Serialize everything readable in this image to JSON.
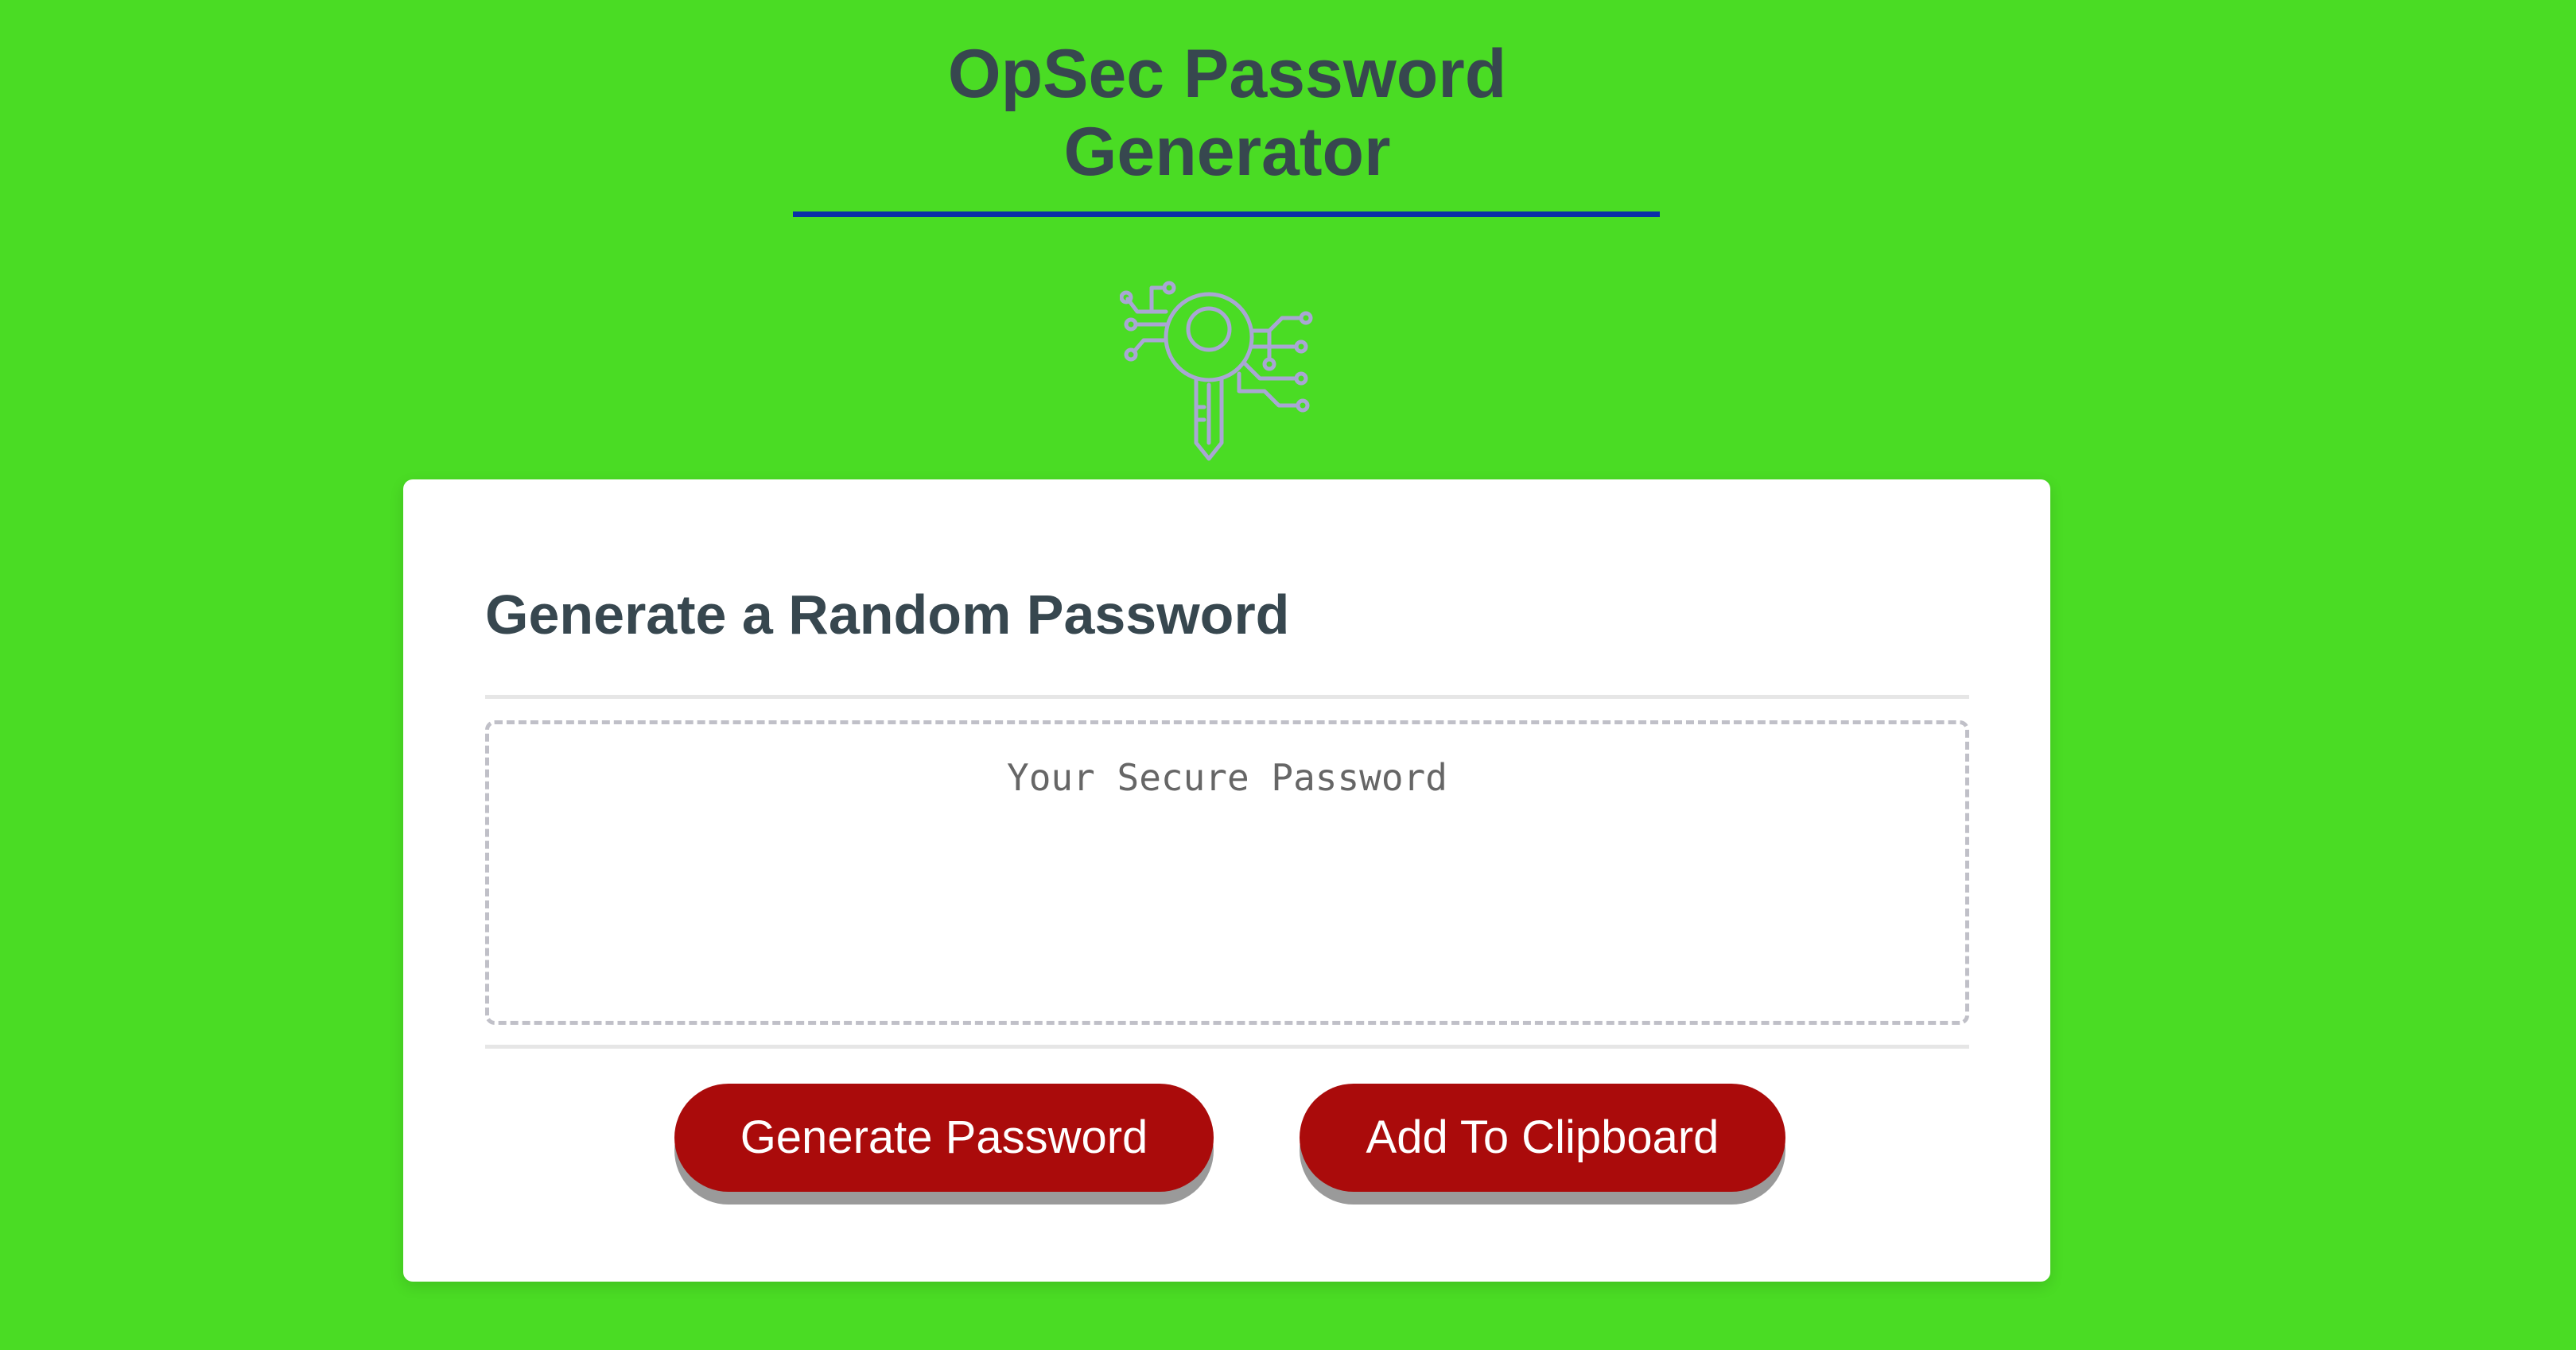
{
  "header": {
    "title_line1": "OpSec Password",
    "title_line2": "Generator"
  },
  "logo": {
    "icon": "key-circuit-icon"
  },
  "card": {
    "title": "Generate a Random Password",
    "password_field": {
      "value": "",
      "placeholder": "Your Secure Password"
    },
    "buttons": {
      "generate_label": "Generate Password",
      "clipboard_label": "Add To Clipboard"
    }
  },
  "colors": {
    "background": "#4adc24",
    "title_text": "#37474f",
    "title_rule": "#0a2fa8",
    "button": "#aa0b0b",
    "button_shadow": "#9a9a9a",
    "icon_stroke": "#a9a6d4"
  }
}
